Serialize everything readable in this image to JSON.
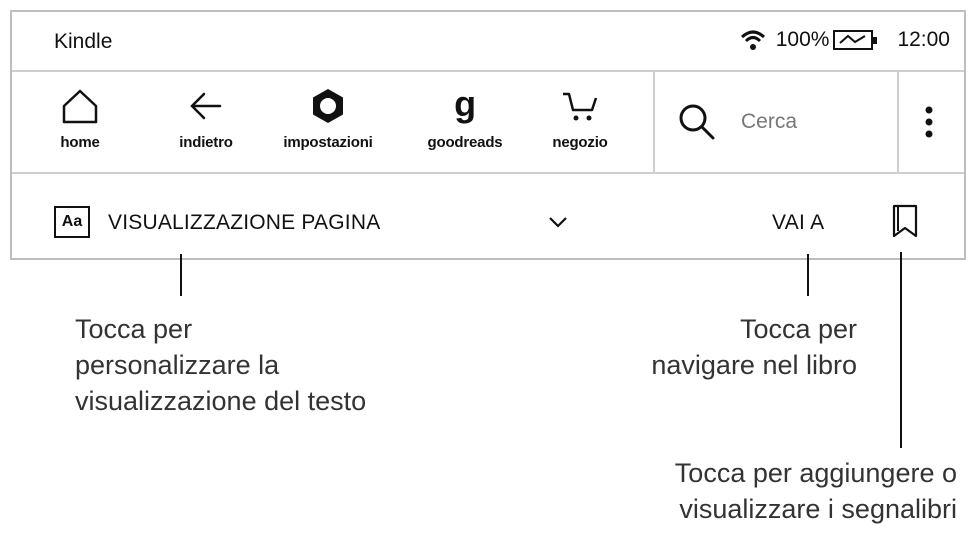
{
  "status_bar": {
    "title": "Kindle",
    "battery": "100%",
    "time": "12:00"
  },
  "toolbar": {
    "items": [
      {
        "label": "home",
        "icon": "home-icon"
      },
      {
        "label": "indietro",
        "icon": "back-arrow-icon"
      },
      {
        "label": "impostazioni",
        "icon": "settings-gear-icon"
      },
      {
        "label": "goodreads",
        "icon": "goodreads-g-icon"
      },
      {
        "label": "negozio",
        "icon": "cart-icon"
      }
    ],
    "search_placeholder": "Cerca"
  },
  "subbar": {
    "aa": "Aa",
    "page_view": "VISUALIZZAZIONE PAGINA",
    "goto": "VAI A"
  },
  "callouts": {
    "left": [
      "Tocca per",
      "personalizzare la",
      "visualizzazione del testo"
    ],
    "middle": [
      "Tocca per",
      "navigare nel libro"
    ],
    "right": [
      "Tocca per aggiungere o",
      "visualizzare i segnalibri"
    ]
  }
}
